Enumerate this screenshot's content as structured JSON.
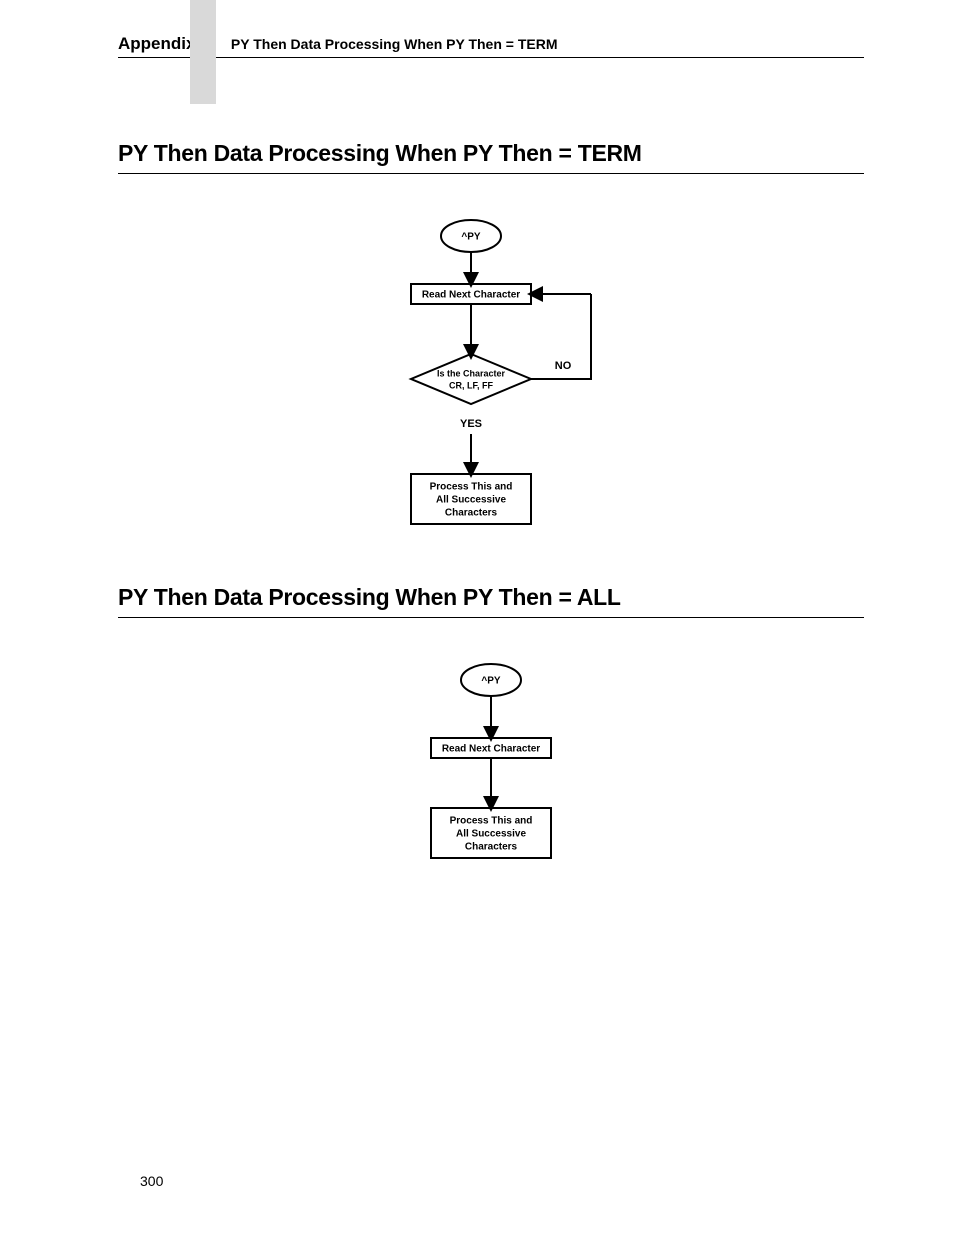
{
  "header": {
    "appendix": "Appendix I",
    "subtitle": "PY Then Data Processing When PY Then = TERM"
  },
  "sections": {
    "term": {
      "title": "PY Then Data Processing When PY Then = TERM",
      "flow": {
        "start": "^PY",
        "read": "Read Next Character",
        "decision_l1": "Is the Character",
        "decision_l2": "CR, LF, FF",
        "yes": "YES",
        "no": "NO",
        "process_l1": "Process This and",
        "process_l2": "All Successive",
        "process_l3": "Characters"
      }
    },
    "all": {
      "title": "PY Then Data Processing When PY Then = ALL",
      "flow": {
        "start": "^PY",
        "read": "Read Next Character",
        "process_l1": "Process This and",
        "process_l2": "All Successive",
        "process_l3": "Characters"
      }
    }
  },
  "page_number": "300"
}
